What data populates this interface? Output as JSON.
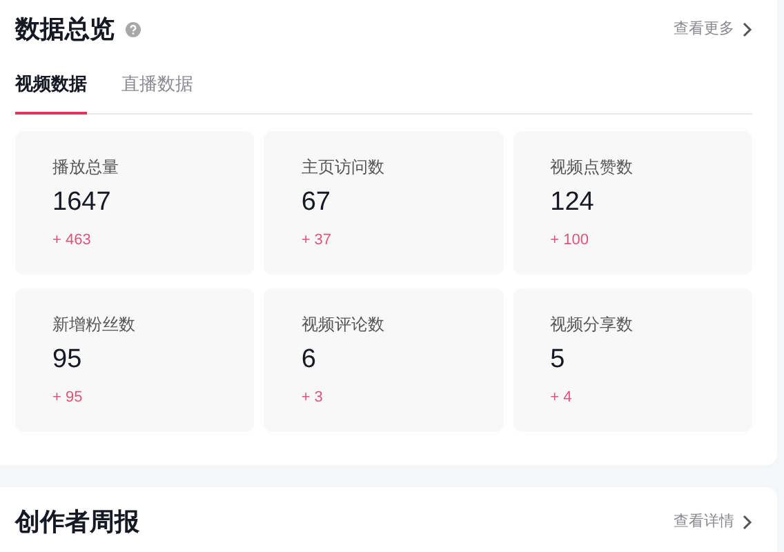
{
  "overview": {
    "title": "数据总览",
    "more_link": "查看更多",
    "tabs": [
      {
        "label": "视频数据",
        "selected": true
      },
      {
        "label": "直播数据",
        "selected": false
      }
    ],
    "metrics": [
      {
        "label": "播放总量",
        "value": "1647",
        "delta": "+ 463"
      },
      {
        "label": "主页访问数",
        "value": "67",
        "delta": "+ 37"
      },
      {
        "label": "视频点赞数",
        "value": "124",
        "delta": "+ 100"
      },
      {
        "label": "新增粉丝数",
        "value": "95",
        "delta": "+ 95"
      },
      {
        "label": "视频评论数",
        "value": "6",
        "delta": "+ 3"
      },
      {
        "label": "视频分享数",
        "value": "5",
        "delta": "+ 4"
      }
    ]
  },
  "weekly_report": {
    "title": "创作者周报",
    "more_link": "查看详情"
  }
}
